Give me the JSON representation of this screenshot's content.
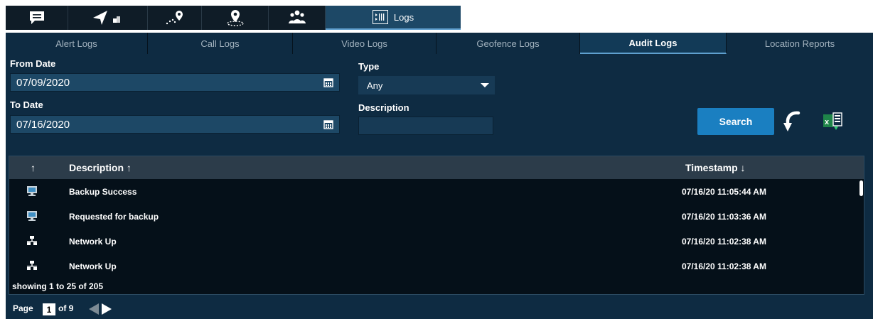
{
  "app": {
    "top_tabs": [
      {
        "icon": "chat-icon"
      },
      {
        "icon": "navigation-icon"
      },
      {
        "icon": "route-map-icon"
      },
      {
        "icon": "location-pin-icon"
      },
      {
        "icon": "group-icon"
      }
    ],
    "active_top_tab": {
      "label": "Logs",
      "icon": "logs-icon"
    }
  },
  "subtabs": [
    {
      "label": "Alert Logs",
      "active": false
    },
    {
      "label": "Call Logs",
      "active": false
    },
    {
      "label": "Video Logs",
      "active": false
    },
    {
      "label": "Geofence Logs",
      "active": false
    },
    {
      "label": "Audit Logs",
      "active": true
    },
    {
      "label": "Location Reports",
      "active": false
    }
  ],
  "filters": {
    "from_date_label": "From Date",
    "from_date_value": "07/09/2020",
    "to_date_label": "To Date",
    "to_date_value": "07/16/2020",
    "type_label": "Type",
    "type_value": "Any",
    "description_label": "Description",
    "description_value": "",
    "search_label": "Search"
  },
  "grid": {
    "headers": {
      "sort": "↑",
      "description": "Description ↑",
      "timestamp": "Timestamp ↓"
    },
    "rows": [
      {
        "icon": "computer-icon",
        "description": "Backup Success",
        "timestamp": "07/16/20 11:05:44 AM"
      },
      {
        "icon": "computer-icon",
        "description": "Requested for backup",
        "timestamp": "07/16/20 11:03:36 AM"
      },
      {
        "icon": "network-icon",
        "description": "Network Up",
        "timestamp": "07/16/20 11:02:38 AM"
      },
      {
        "icon": "network-icon",
        "description": "Network Up",
        "timestamp": "07/16/20 11:02:38 AM"
      }
    ],
    "showing": "showing 1 to 25 of 205"
  },
  "pager": {
    "page_label": "Page",
    "current_page": "1",
    "of_label": "of 9"
  },
  "colors": {
    "panel": "#0e2b42",
    "grid_bg": "#051019",
    "accent": "#1a7fc1",
    "excel_green": "#1e8449"
  }
}
